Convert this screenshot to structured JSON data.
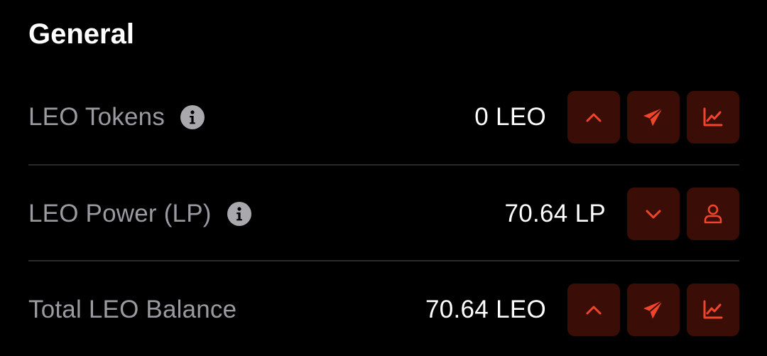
{
  "section": {
    "title": "General"
  },
  "colors": {
    "background": "#000000",
    "label": "#9a9aa0",
    "value": "#ffffff",
    "button_bg": "#3b0d07",
    "accent": "#f0452b",
    "divider": "#2a2a2c"
  },
  "rows": [
    {
      "label": "LEO Tokens",
      "has_info": true,
      "info_icon": "info-icon",
      "value": "0 LEO",
      "actions": [
        "chevron-up-icon",
        "send-icon",
        "chart-icon"
      ]
    },
    {
      "label": "LEO Power (LP)",
      "has_info": true,
      "info_icon": "info-icon",
      "value": "70.64 LP",
      "actions": [
        "chevron-down-icon",
        "user-icon"
      ]
    },
    {
      "label": "Total LEO Balance",
      "has_info": false,
      "value": "70.64 LEO",
      "actions": [
        "chevron-up-icon",
        "send-icon",
        "chart-icon"
      ]
    }
  ]
}
